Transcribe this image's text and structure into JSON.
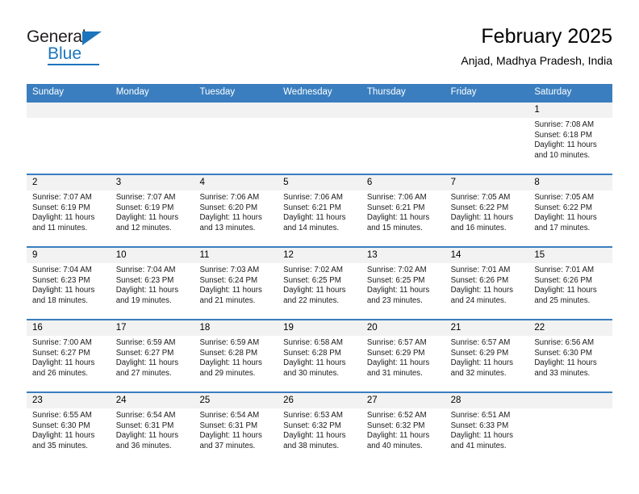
{
  "brand": {
    "name_part1": "General",
    "name_part2": "Blue",
    "accent_color": "#1c75bc"
  },
  "header": {
    "title": "February 2025",
    "subtitle": "Anjad, Madhya Pradesh, India"
  },
  "theme": {
    "header_row_color": "#3a7ebf",
    "date_band_color": "#f2f2f2",
    "cell_background": "#ffffff"
  },
  "weekdays": [
    "Sunday",
    "Monday",
    "Tuesday",
    "Wednesday",
    "Thursday",
    "Friday",
    "Saturday"
  ],
  "weeks": [
    [
      {
        "empty": true
      },
      {
        "empty": true
      },
      {
        "empty": true
      },
      {
        "empty": true
      },
      {
        "empty": true
      },
      {
        "empty": true
      },
      {
        "day": "1",
        "sunrise": "Sunrise: 7:08 AM",
        "sunset": "Sunset: 6:18 PM",
        "daylight1": "Daylight: 11 hours",
        "daylight2": "and 10 minutes."
      }
    ],
    [
      {
        "day": "2",
        "sunrise": "Sunrise: 7:07 AM",
        "sunset": "Sunset: 6:19 PM",
        "daylight1": "Daylight: 11 hours",
        "daylight2": "and 11 minutes."
      },
      {
        "day": "3",
        "sunrise": "Sunrise: 7:07 AM",
        "sunset": "Sunset: 6:19 PM",
        "daylight1": "Daylight: 11 hours",
        "daylight2": "and 12 minutes."
      },
      {
        "day": "4",
        "sunrise": "Sunrise: 7:06 AM",
        "sunset": "Sunset: 6:20 PM",
        "daylight1": "Daylight: 11 hours",
        "daylight2": "and 13 minutes."
      },
      {
        "day": "5",
        "sunrise": "Sunrise: 7:06 AM",
        "sunset": "Sunset: 6:21 PM",
        "daylight1": "Daylight: 11 hours",
        "daylight2": "and 14 minutes."
      },
      {
        "day": "6",
        "sunrise": "Sunrise: 7:06 AM",
        "sunset": "Sunset: 6:21 PM",
        "daylight1": "Daylight: 11 hours",
        "daylight2": "and 15 minutes."
      },
      {
        "day": "7",
        "sunrise": "Sunrise: 7:05 AM",
        "sunset": "Sunset: 6:22 PM",
        "daylight1": "Daylight: 11 hours",
        "daylight2": "and 16 minutes."
      },
      {
        "day": "8",
        "sunrise": "Sunrise: 7:05 AM",
        "sunset": "Sunset: 6:22 PM",
        "daylight1": "Daylight: 11 hours",
        "daylight2": "and 17 minutes."
      }
    ],
    [
      {
        "day": "9",
        "sunrise": "Sunrise: 7:04 AM",
        "sunset": "Sunset: 6:23 PM",
        "daylight1": "Daylight: 11 hours",
        "daylight2": "and 18 minutes."
      },
      {
        "day": "10",
        "sunrise": "Sunrise: 7:04 AM",
        "sunset": "Sunset: 6:23 PM",
        "daylight1": "Daylight: 11 hours",
        "daylight2": "and 19 minutes."
      },
      {
        "day": "11",
        "sunrise": "Sunrise: 7:03 AM",
        "sunset": "Sunset: 6:24 PM",
        "daylight1": "Daylight: 11 hours",
        "daylight2": "and 21 minutes."
      },
      {
        "day": "12",
        "sunrise": "Sunrise: 7:02 AM",
        "sunset": "Sunset: 6:25 PM",
        "daylight1": "Daylight: 11 hours",
        "daylight2": "and 22 minutes."
      },
      {
        "day": "13",
        "sunrise": "Sunrise: 7:02 AM",
        "sunset": "Sunset: 6:25 PM",
        "daylight1": "Daylight: 11 hours",
        "daylight2": "and 23 minutes."
      },
      {
        "day": "14",
        "sunrise": "Sunrise: 7:01 AM",
        "sunset": "Sunset: 6:26 PM",
        "daylight1": "Daylight: 11 hours",
        "daylight2": "and 24 minutes."
      },
      {
        "day": "15",
        "sunrise": "Sunrise: 7:01 AM",
        "sunset": "Sunset: 6:26 PM",
        "daylight1": "Daylight: 11 hours",
        "daylight2": "and 25 minutes."
      }
    ],
    [
      {
        "day": "16",
        "sunrise": "Sunrise: 7:00 AM",
        "sunset": "Sunset: 6:27 PM",
        "daylight1": "Daylight: 11 hours",
        "daylight2": "and 26 minutes."
      },
      {
        "day": "17",
        "sunrise": "Sunrise: 6:59 AM",
        "sunset": "Sunset: 6:27 PM",
        "daylight1": "Daylight: 11 hours",
        "daylight2": "and 27 minutes."
      },
      {
        "day": "18",
        "sunrise": "Sunrise: 6:59 AM",
        "sunset": "Sunset: 6:28 PM",
        "daylight1": "Daylight: 11 hours",
        "daylight2": "and 29 minutes."
      },
      {
        "day": "19",
        "sunrise": "Sunrise: 6:58 AM",
        "sunset": "Sunset: 6:28 PM",
        "daylight1": "Daylight: 11 hours",
        "daylight2": "and 30 minutes."
      },
      {
        "day": "20",
        "sunrise": "Sunrise: 6:57 AM",
        "sunset": "Sunset: 6:29 PM",
        "daylight1": "Daylight: 11 hours",
        "daylight2": "and 31 minutes."
      },
      {
        "day": "21",
        "sunrise": "Sunrise: 6:57 AM",
        "sunset": "Sunset: 6:29 PM",
        "daylight1": "Daylight: 11 hours",
        "daylight2": "and 32 minutes."
      },
      {
        "day": "22",
        "sunrise": "Sunrise: 6:56 AM",
        "sunset": "Sunset: 6:30 PM",
        "daylight1": "Daylight: 11 hours",
        "daylight2": "and 33 minutes."
      }
    ],
    [
      {
        "day": "23",
        "sunrise": "Sunrise: 6:55 AM",
        "sunset": "Sunset: 6:30 PM",
        "daylight1": "Daylight: 11 hours",
        "daylight2": "and 35 minutes."
      },
      {
        "day": "24",
        "sunrise": "Sunrise: 6:54 AM",
        "sunset": "Sunset: 6:31 PM",
        "daylight1": "Daylight: 11 hours",
        "daylight2": "and 36 minutes."
      },
      {
        "day": "25",
        "sunrise": "Sunrise: 6:54 AM",
        "sunset": "Sunset: 6:31 PM",
        "daylight1": "Daylight: 11 hours",
        "daylight2": "and 37 minutes."
      },
      {
        "day": "26",
        "sunrise": "Sunrise: 6:53 AM",
        "sunset": "Sunset: 6:32 PM",
        "daylight1": "Daylight: 11 hours",
        "daylight2": "and 38 minutes."
      },
      {
        "day": "27",
        "sunrise": "Sunrise: 6:52 AM",
        "sunset": "Sunset: 6:32 PM",
        "daylight1": "Daylight: 11 hours",
        "daylight2": "and 40 minutes."
      },
      {
        "day": "28",
        "sunrise": "Sunrise: 6:51 AM",
        "sunset": "Sunset: 6:33 PM",
        "daylight1": "Daylight: 11 hours",
        "daylight2": "and 41 minutes."
      },
      {
        "empty": true
      }
    ]
  ]
}
